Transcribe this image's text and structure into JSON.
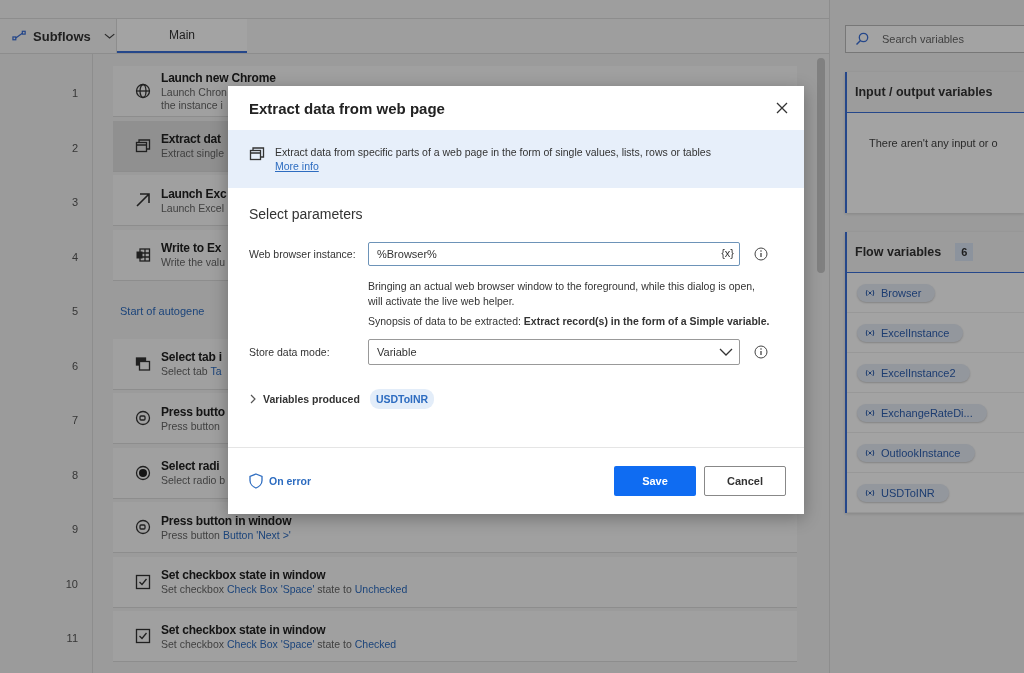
{
  "subflows_button": {
    "label": "Subflows"
  },
  "tabs": [
    {
      "label": "Main",
      "selected": true
    }
  ],
  "steps": [
    {
      "number": "1",
      "kind": "globe",
      "title": "Launch new Chrome",
      "lines": [
        [
          {
            "text": "Launch Chron",
            "link": false
          }
        ],
        [
          {
            "text": "the instance i",
            "link": false
          }
        ]
      ],
      "selected": false
    },
    {
      "number": "2",
      "kind": "window",
      "title": "Extract dat",
      "lines": [
        [
          {
            "text": "Extract single",
            "link": false
          }
        ]
      ],
      "selected": true
    },
    {
      "number": "3",
      "kind": "arrow",
      "title": "Launch Exc",
      "lines": [
        [
          {
            "text": "Launch Excel",
            "link": false
          }
        ]
      ],
      "selected": false
    },
    {
      "number": "4",
      "kind": "excel",
      "title": "Write to Ex",
      "lines": [
        [
          {
            "text": "Write the valu",
            "link": false
          }
        ]
      ],
      "selected": false
    },
    {
      "number": "5",
      "kind": "label",
      "title": "Start of autogene"
    },
    {
      "number": "6",
      "kind": "tab",
      "title": "Select tab i",
      "lines": [
        [
          {
            "text": "Select tab ",
            "link": false
          },
          {
            "text": "Ta",
            "link": true
          }
        ]
      ],
      "selected": false
    },
    {
      "number": "7",
      "kind": "button",
      "title": "Press butto",
      "lines": [
        [
          {
            "text": "Press button",
            "link": false
          }
        ]
      ],
      "selected": false
    },
    {
      "number": "8",
      "kind": "radio",
      "title": "Select radi",
      "lines": [
        [
          {
            "text": "Select radio b",
            "link": false
          }
        ]
      ],
      "selected": false
    },
    {
      "number": "9",
      "kind": "button",
      "title": "Press button in window",
      "lines": [
        [
          {
            "text": "Press button ",
            "link": false
          },
          {
            "text": "Button 'Next >'",
            "link": true
          }
        ]
      ],
      "selected": false
    },
    {
      "number": "10",
      "kind": "checkbox",
      "title": "Set checkbox state in window",
      "lines": [
        [
          {
            "text": "Set checkbox ",
            "link": false
          },
          {
            "text": "Check Box 'Space'",
            "link": true
          },
          {
            "text": " state to ",
            "link": false
          },
          {
            "text": "Unchecked",
            "link": true
          }
        ]
      ],
      "selected": false
    },
    {
      "number": "11",
      "kind": "checkbox",
      "title": "Set checkbox state in window",
      "lines": [
        [
          {
            "text": "Set checkbox ",
            "link": false
          },
          {
            "text": "Check Box 'Space'",
            "link": true
          },
          {
            "text": " state to ",
            "link": false
          },
          {
            "text": "Checked",
            "link": true
          }
        ]
      ],
      "selected": false
    }
  ],
  "variables_panel": {
    "search": {
      "placeholder": "Search variables"
    },
    "io_section": {
      "title": "Input / output variables",
      "empty_text": "There aren't any input or o"
    },
    "flow_section": {
      "title": "Flow variables",
      "count": "6",
      "items": [
        "Browser",
        "ExcelInstance",
        "ExcelInstance2",
        "ExchangeRateDi...",
        "OutlookInstance",
        "USDToINR"
      ]
    }
  },
  "dialog": {
    "title": "Extract data from web page",
    "info": {
      "text": "Extract data from specific parts of a web page in the form of single values, lists, rows or tables",
      "link": "More info"
    },
    "section_title": "Select parameters",
    "browser_field": {
      "label": "Web browser instance:",
      "value": "%Browser%",
      "var_button": "{x}"
    },
    "hint": "Bringing an actual web browser window to the foreground, while this dialog is open, will activate the live web helper.",
    "synopsis": "Synopsis of data to be extracted: **Extract record(s) in the form of a Simple variable.**",
    "store_mode": {
      "label": "Store data mode:",
      "value": "Variable"
    },
    "variables_produced": {
      "label": "Variables produced",
      "expanded": false,
      "chips": [
        "USDToINR"
      ]
    },
    "on_error": "On error",
    "save": "Save",
    "cancel": "Cancel"
  }
}
